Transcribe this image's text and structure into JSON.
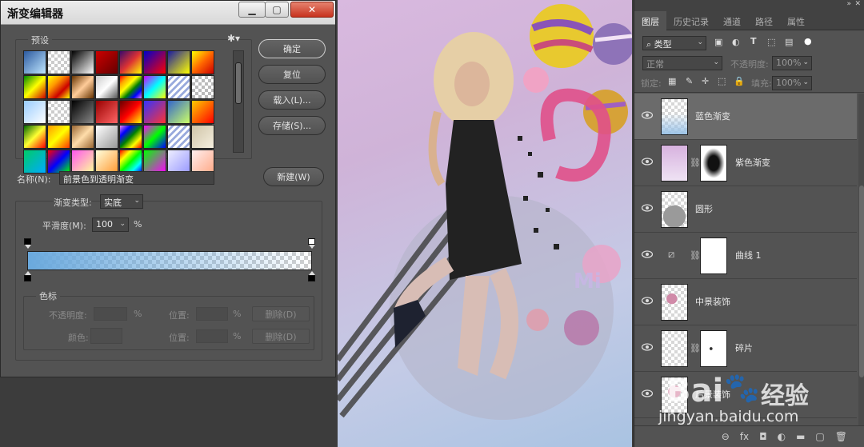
{
  "dialog": {
    "title": "渐变编辑器",
    "presets_label": "预设",
    "preset_swatches": [
      "linear-gradient(135deg,#2c5aa0,#bfe6ff)",
      "repeating-conic-gradient(#fff 0% 25%,#ccc 0% 50%) 0 0/8px 8px",
      "linear-gradient(135deg,#000,#fff)",
      "linear-gradient(135deg,#c00,#600)",
      "linear-gradient(135deg,#3b0a6b,#d33,#ff0)",
      "linear-gradient(135deg,#00c,#f00)",
      "linear-gradient(135deg,#1a1aa0,#ff0)",
      "linear-gradient(135deg,#ff0,#f60,#c00)",
      "linear-gradient(135deg,#080,#ff0,#c00)",
      "linear-gradient(135deg,#ff0,#f90,#c00,#ff0)",
      "linear-gradient(135deg,#630,#fc9,#630)",
      "linear-gradient(135deg,#ccc,#fff,#555)",
      "linear-gradient(135deg,red,orange,yellow,green,blue,violet)",
      "linear-gradient(135deg,#c0f,#0ff,#ff0)",
      "repeating-linear-gradient(135deg,#fff 0 3px,#9ad 3px 6px)",
      "repeating-conic-gradient(#fff 0% 25%,#bbb 0% 50%) 0 0/8px 8px",
      "linear-gradient(135deg,#9cf,#fff)",
      "repeating-conic-gradient(#fff 0% 25%,#ccc 0% 50%) 0 0/8px 8px",
      "linear-gradient(135deg,#000,#888)",
      "linear-gradient(135deg,#900,#f66)",
      "linear-gradient(135deg,#600,#f00,#ff0)",
      "linear-gradient(135deg,#33f,#f33)",
      "linear-gradient(135deg,#36c,#cf6)",
      "linear-gradient(135deg,#fc0,#f00)",
      "linear-gradient(135deg,#060,#ff3,#f00)",
      "linear-gradient(135deg,#f90,#ff0,#f30)",
      "linear-gradient(135deg,#963,#fda,#963)",
      "linear-gradient(135deg,#fff,#999)",
      "linear-gradient(135deg,violet,blue,green,yellow,red)",
      "linear-gradient(135deg,#f0f,#0f0,#00f)",
      "repeating-linear-gradient(135deg,#fff 0 3px,#9ad 3px 6px)",
      "linear-gradient(135deg,#cfc4a8,#f5efdf)",
      "linear-gradient(135deg,#0c6,#0af)",
      "linear-gradient(135deg,#f00,#00f,#0f0)",
      "linear-gradient(135deg,#f5e,#ff9)",
      "linear-gradient(135deg,#ffd,#f93)",
      "linear-gradient(135deg,red,yellow,lime,cyan,blue)",
      "linear-gradient(135deg,#0f0,#f0f)",
      "linear-gradient(135deg,#eef,#99f)",
      "linear-gradient(135deg,#fee,#fa8)"
    ],
    "buttons": {
      "ok": "确定",
      "reset": "复位",
      "load": "载入(L)...",
      "save": "存储(S)...",
      "new": "新建(W)"
    },
    "name_label": "名称(N):",
    "name_value": "前景色到透明渐变",
    "gradient_type_label": "渐变类型:",
    "gradient_type_value": "实底",
    "smoothness_label": "平滑度(M):",
    "smoothness_value": "100",
    "smoothness_unit": "%",
    "gradient": {
      "start_color": "#6aa9dd",
      "end_opacity": 0
    },
    "color_stops": {
      "label": "色标",
      "opacity_label": "不透明度:",
      "percent": "%",
      "location_label": "位置:",
      "delete_label": "删除(D)",
      "color_label": "颜色:"
    }
  },
  "panel": {
    "tabs": [
      "图层",
      "历史记录",
      "通道",
      "路径",
      "属性"
    ],
    "filter_label": "类型",
    "blend_mode": "正常",
    "opacity_label": "不透明度:",
    "opacity_value": "100%",
    "lock_label": "锁定:",
    "fill_label": "填充:",
    "fill_value": "100%",
    "layers": [
      {
        "name": "蓝色渐变",
        "selected": true,
        "mask": false
      },
      {
        "name": "紫色渐变",
        "selected": false,
        "mask": true
      },
      {
        "name": "圆形",
        "selected": false,
        "mask": false
      },
      {
        "name": "曲线 1",
        "selected": false,
        "mask": true
      },
      {
        "name": "中景装饰",
        "selected": false,
        "mask": false
      },
      {
        "name": "碎片",
        "selected": false,
        "mask": true
      },
      {
        "name": "后景装饰",
        "selected": false,
        "mask": false
      }
    ],
    "bottom_icons": [
      "link-icon",
      "fx-icon",
      "mask-icon",
      "adjustment-icon",
      "folder-icon",
      "new-layer-icon",
      "trash-icon"
    ],
    "bottom_labels": [
      "⊖",
      "fx",
      "◘",
      "◐",
      "▬",
      "▢",
      "🗑"
    ]
  },
  "watermark": {
    "brand": "Bai",
    "cn": "经验",
    "url": "jingyan.baidu.com"
  }
}
